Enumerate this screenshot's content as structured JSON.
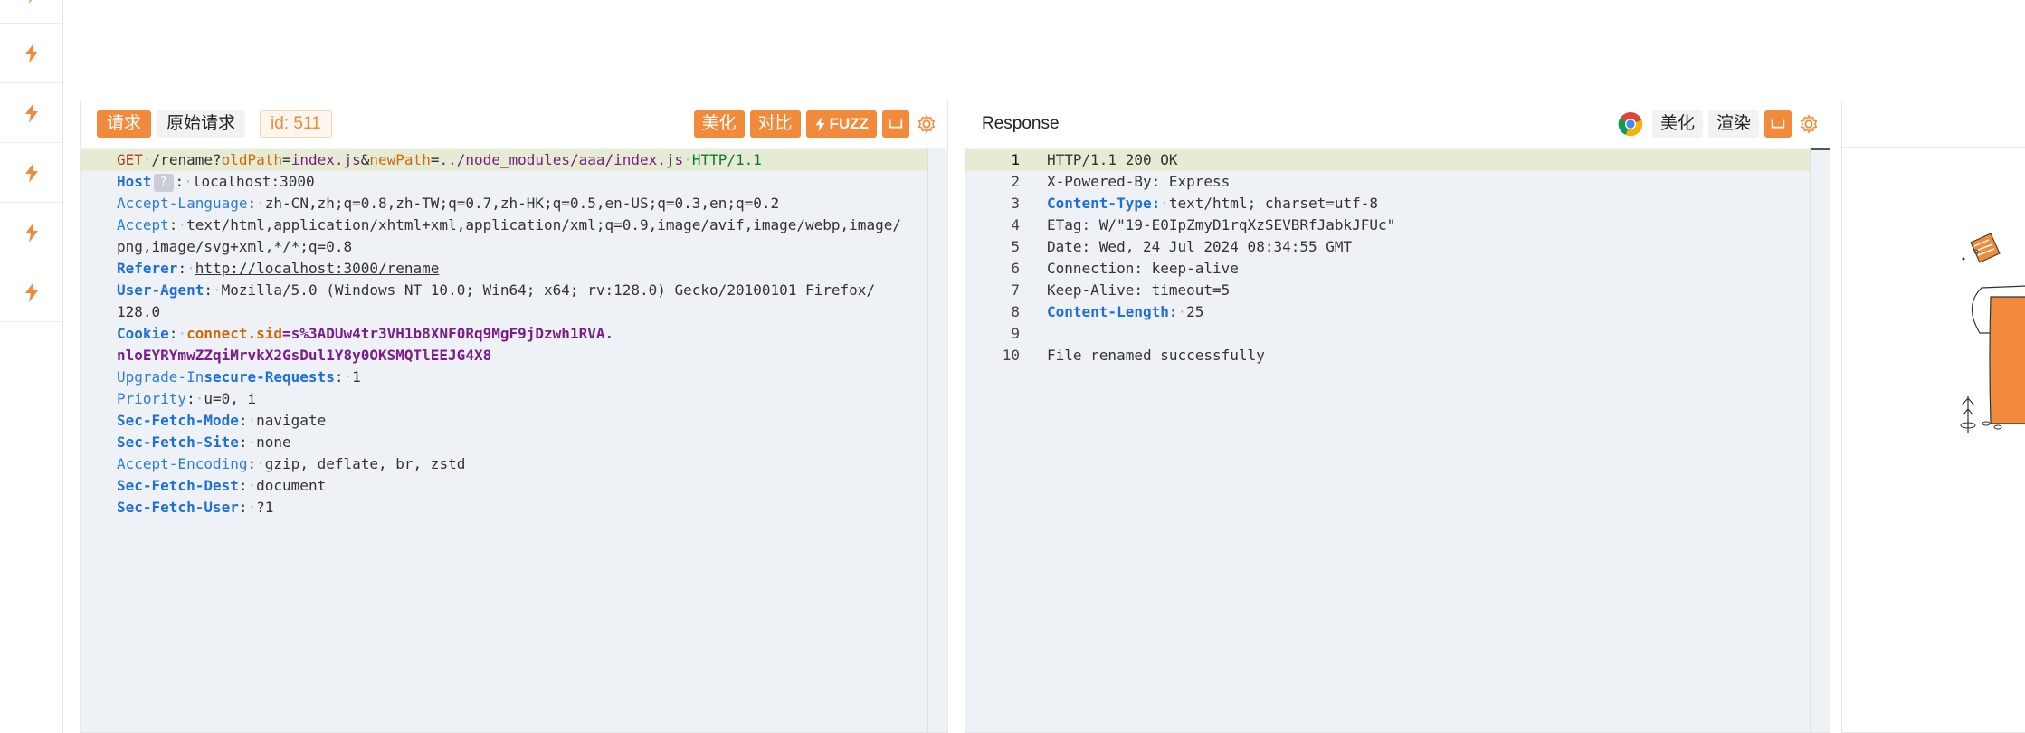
{
  "rail": {
    "items": [
      "fuzz-item",
      "fuzz-item",
      "fuzz-item",
      "fuzz-item",
      "fuzz-item"
    ]
  },
  "request": {
    "tabs": {
      "request": "请求",
      "raw": "原始请求"
    },
    "id_badge": "id: 511",
    "buttons": {
      "beautify": "美化",
      "compare": "对比",
      "fuzz": "FUZZ"
    },
    "line1": {
      "method": "GET",
      "path": "/rename?",
      "p1": "oldPath",
      "eq1": "=",
      "v1": "index.js",
      "amp": "&",
      "p2": "newPath",
      "eq2": "=",
      "v2": "../node_modules/aaa/index.js",
      "proto": "HTTP/1.1"
    },
    "headers": {
      "host": {
        "k": "Host",
        "v": "localhost:3000"
      },
      "accept_language": {
        "k": "Accept-Language",
        "v": "zh-CN,zh;q=0.8,zh-TW;q=0.7,zh-HK;q=0.5,en-US;q=0.3,en;q=0.2"
      },
      "accept": {
        "k": "Accept",
        "v1": "text/html,application/xhtml+xml,application/xml;q=0.9,image/avif,image/webp,image/",
        "v2": "png,image/svg+xml,*/*;q=0.8"
      },
      "referer": {
        "k": "Referer",
        "v": "http://localhost:3000/rename"
      },
      "user_agent": {
        "k": "User-Agent",
        "v1": "Mozilla/5.0 (Windows NT 10.0; Win64; x64; rv:128.0) Gecko/20100101 Firefox/",
        "v2": "128.0"
      },
      "cookie": {
        "k": "Cookie",
        "name": "connect.sid",
        "eq": "=",
        "v1": "s%3ADUw4tr3VH1b8XNF0Rq9MgF9jDzwh1RVA.",
        "v2": "nloEYRYmwZZqiMrvkX2GsDul1Y8y0OKSMQTlEEJG4X8"
      },
      "upgrade": {
        "k1": "Upgrade-In",
        "k2": "secure-Requests",
        "v": "1"
      },
      "priority": {
        "k": "Priority",
        "v": "u=0, i"
      },
      "sec_fetch_mode": {
        "k": "Sec-Fetch-Mode",
        "v": "navigate"
      },
      "sec_fetch_site": {
        "k": "Sec-Fetch-Site",
        "v": "none"
      },
      "accept_encoding": {
        "k": "Accept-Encoding",
        "v": "gzip, deflate, br, zstd"
      },
      "sec_fetch_dest": {
        "k": "Sec-Fetch-Dest",
        "v": "document"
      },
      "sec_fetch_user": {
        "k": "Sec-Fetch-User",
        "v": "?1"
      }
    }
  },
  "response": {
    "title": "Response",
    "buttons": {
      "beautify": "美化",
      "render": "渲染"
    },
    "line_numbers": [
      "1",
      "2",
      "3",
      "4",
      "5",
      "6",
      "7",
      "8",
      "9",
      "10"
    ],
    "lines": {
      "status": "HTTP/1.1 200 OK",
      "powered": "X-Powered-By: Express",
      "ctype_k": "Content-Type:",
      "ctype_v": "text/html; charset=utf-8",
      "etag": "ETag: W/\"19-E0IpZmyD1rqXzSEVBRfJabkJFUc\"",
      "date": "Date: Wed, 24 Jul 2024 08:34:55 GMT",
      "connection": "Connection: keep-alive",
      "keepalive": "Keep-Alive: timeout=5",
      "clen_k": "Content-Length:",
      "clen_v": "25",
      "body": "File renamed successfully"
    }
  },
  "colors": {
    "accent": "#f28a3c",
    "editor_bg": "#eef1f5",
    "key_blue": "#1e6fd9",
    "param_orange": "#d1680b",
    "value_purple": "#7a1c8c"
  }
}
